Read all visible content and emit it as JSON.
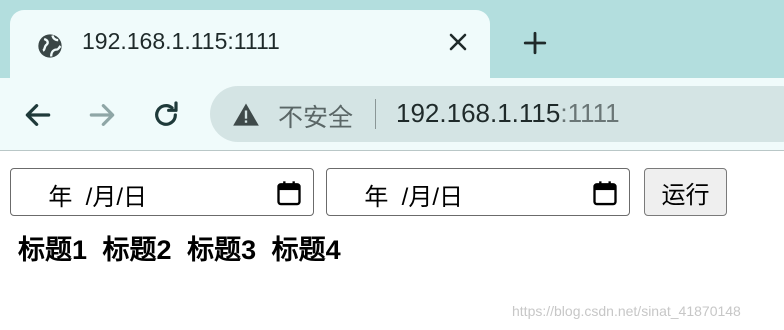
{
  "browser": {
    "tab": {
      "title": "192.168.1.115:1111"
    },
    "address_bar": {
      "security_text": "不安全",
      "host": "192.168.1.115",
      "port": ":1111"
    },
    "icons": {
      "tab_favicon": "globe-icon",
      "tab_close": "close-icon",
      "new_tab": "plus-icon",
      "back": "back-arrow-icon",
      "forward": "forward-arrow-icon",
      "reload": "reload-icon",
      "security": "warning-icon"
    }
  },
  "page": {
    "start_date": {
      "display": "  年  /月/日",
      "icon": "calendar-icon"
    },
    "end_date": {
      "display": "  年  /月/日",
      "icon": "calendar-icon"
    },
    "run_button_label": "运行",
    "headings": [
      "标题1",
      "标题2",
      "标题3",
      "标题4"
    ],
    "watermark": "https://blog.csdn.net/sinat_41870148"
  },
  "colors": {
    "tab_strip": "#b3dede",
    "toolbar": "#f0fbfb",
    "omnibox": "#d4e4e4",
    "disabled_icon": "#8fa6a6",
    "icon": "#1f3a3a"
  }
}
